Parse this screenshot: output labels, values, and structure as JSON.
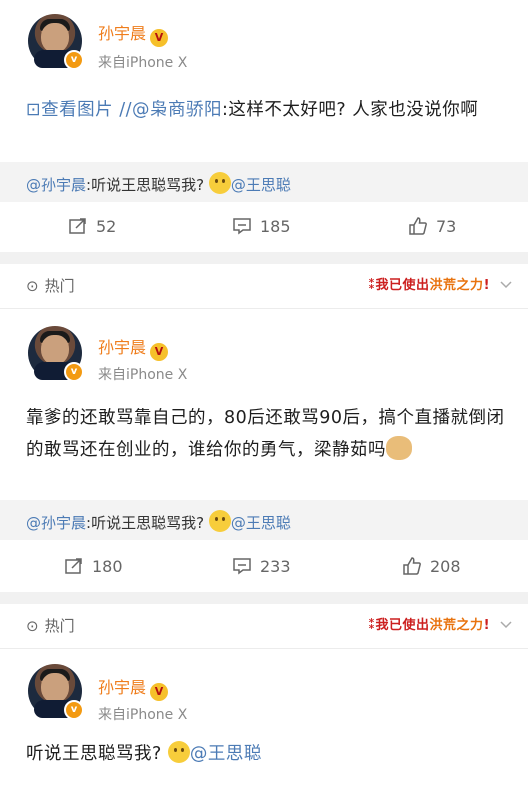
{
  "posts": [
    {
      "author": "孙宇晨",
      "source": "来自iPhone X",
      "body_prefix": "查看图片 //",
      "body_mention": "@枭商骄阳",
      "body_text": ":这样不太好吧?  人家也没说你啊",
      "repost_author": "@孙宇晨",
      "repost_text": ":听说王思聪骂我?",
      "repost_mention": "@王思聪",
      "reposts": "52",
      "comments": "185",
      "likes": "73"
    },
    {
      "author": "孙宇晨",
      "source": "来自iPhone X",
      "body_text": "靠爹的还敢骂靠自己的，80后还敢骂90后，搞个直播就倒闭的敢骂还在创业的，谁给你的勇气，梁静茹吗",
      "repost_author": "@孙宇晨",
      "repost_text": ":听说王思聪骂我?",
      "repost_mention": "@王思聪",
      "reposts": "180",
      "comments": "233",
      "likes": "208"
    },
    {
      "author": "孙宇晨",
      "source": "来自iPhone X",
      "body_text": "听说王思聪骂我?",
      "body_mention": "@王思聪"
    }
  ],
  "hot": {
    "label": "热门",
    "slogan_a": "我已使出",
    "slogan_b": "洪荒之力",
    "slogan_c": "!"
  },
  "colors": {
    "name": "#ef7d1c",
    "link": "#4c7bb5",
    "divider": "#f1f1f1"
  },
  "icons": [
    "avatar",
    "vip-badge",
    "image-icon",
    "repost-icon",
    "comment-icon",
    "like-icon",
    "hot-icon",
    "chevron-down-icon"
  ]
}
